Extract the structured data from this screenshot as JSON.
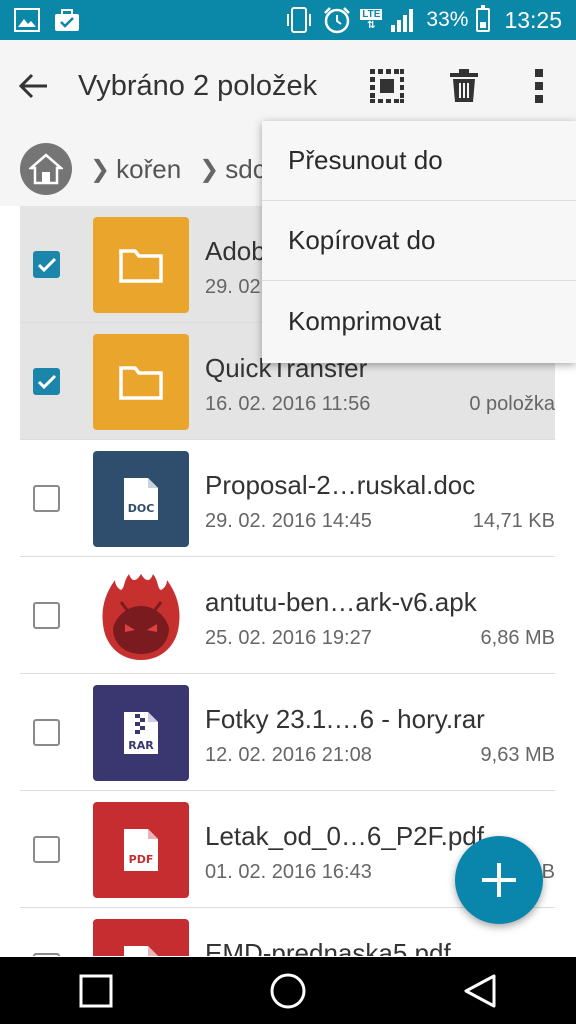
{
  "status_bar": {
    "battery_percent": "33%",
    "time": "13:25",
    "network": "LTE"
  },
  "toolbar": {
    "title": "Vybráno 2 položek"
  },
  "breadcrumb": {
    "items": [
      "kořen",
      "sdc"
    ]
  },
  "overflow_menu": {
    "items": [
      "Přesunout do",
      "Kopírovat do",
      "Komprimovat"
    ]
  },
  "files": [
    {
      "name": "Adob",
      "date": "29. 02",
      "size": "",
      "selected": true,
      "type": "folder"
    },
    {
      "name": "QuickTransfer",
      "date": "16. 02. 2016 11:56",
      "size": "0 položka",
      "selected": true,
      "type": "folder"
    },
    {
      "name": "Proposal-2…ruskal.doc",
      "date": "29. 02. 2016 14:45",
      "size": "14,71 KB",
      "selected": false,
      "type": "doc",
      "badge": "DOC"
    },
    {
      "name": "antutu-ben…ark-v6.apk",
      "date": "25. 02. 2016 19:27",
      "size": "6,86 MB",
      "selected": false,
      "type": "apk"
    },
    {
      "name": "Fotky 23.1.…6 - hory.rar",
      "date": "12. 02. 2016 21:08",
      "size": "9,63 MB",
      "selected": false,
      "type": "rar",
      "badge": "RAR"
    },
    {
      "name": "Letak_od_0…6_P2F.pdf",
      "date": "01. 02. 2016 16:43",
      "size": "B",
      "selected": false,
      "type": "pdf",
      "badge": "PDF"
    },
    {
      "name": "EMD-prednaska5.pdf",
      "date": "",
      "size": "",
      "selected": false,
      "type": "pdf"
    }
  ],
  "colors": {
    "accent": "#0b87a8",
    "folder": "#eaa52c",
    "doc": "#2f4e6e",
    "rar": "#3a3670",
    "pdf": "#c62d31",
    "apk": "#c6302f"
  }
}
